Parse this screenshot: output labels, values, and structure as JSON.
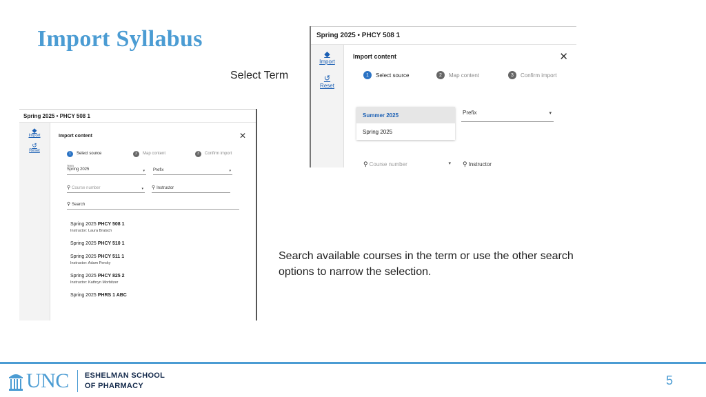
{
  "slide": {
    "title": "Import Syllabus",
    "select_term_note": "Select Term",
    "caption": "Search available courses in the term or use the other search options to narrow the selection.",
    "page_number": "5"
  },
  "left_screenshot": {
    "course_title": "Spring 2025 • PHCY 508 1",
    "rail": {
      "import_label": "Import",
      "reset_label": "Reset"
    },
    "dialog_title": "Import content",
    "steps": [
      {
        "num": "1",
        "label": "Select source"
      },
      {
        "num": "2",
        "label": "Map content"
      },
      {
        "num": "3",
        "label": "Confirm import"
      }
    ],
    "term_field": {
      "label": "Term",
      "value": "Spring 2025"
    },
    "prefix_field": {
      "value": "Prefix"
    },
    "course_number_field": {
      "placeholder": "Course number"
    },
    "instructor_field": {
      "value": "Instructor"
    },
    "search_field": {
      "placeholder": "Search"
    },
    "courses": [
      {
        "term": "Spring 2025",
        "code": "PHCY 508 1",
        "instructor": "Instructor: Laura Bratsch"
      },
      {
        "term": "Spring 2025",
        "code": "PHCY 510 1",
        "instructor": ""
      },
      {
        "term": "Spring 2025",
        "code": "PHCY 511 1",
        "instructor": "Instructor: Adam Persky"
      },
      {
        "term": "Spring 2025",
        "code": "PHCY 825 2",
        "instructor": "Instructor: Kathryn Morbitzer"
      },
      {
        "term": "Spring 2025",
        "code": "PHRS 1 ABC",
        "instructor": ""
      }
    ]
  },
  "right_screenshot": {
    "course_title": "Spring 2025 • PHCY 508 1",
    "rail": {
      "import_label": "Import",
      "reset_label": "Reset"
    },
    "dialog_title": "Import content",
    "steps": [
      {
        "num": "1",
        "label": "Select source"
      },
      {
        "num": "2",
        "label": "Map content"
      },
      {
        "num": "3",
        "label": "Confirm import"
      }
    ],
    "term_options": [
      "Summer 2025",
      "Spring 2025"
    ],
    "selected_term_index": 0,
    "prefix_field": {
      "value": "Prefix"
    },
    "course_number_field": {
      "placeholder": "Course number"
    },
    "instructor_field": {
      "value": "Instructor"
    }
  },
  "footer": {
    "logo_text": "UNC",
    "school_line_1": "ESHELMAN SCHOOL",
    "school_line_2": "OF PHARMACY"
  },
  "colors": {
    "accent": "#4b9cd3",
    "navy": "#13294b",
    "link": "#1a5fb4",
    "active_step": "#2b73c4"
  },
  "icons": {
    "import": "layers-icon",
    "reset": "history-icon",
    "close": "close-icon",
    "search": "search-icon",
    "dropdown": "chevron-down-icon",
    "logo": "old-well-icon"
  }
}
